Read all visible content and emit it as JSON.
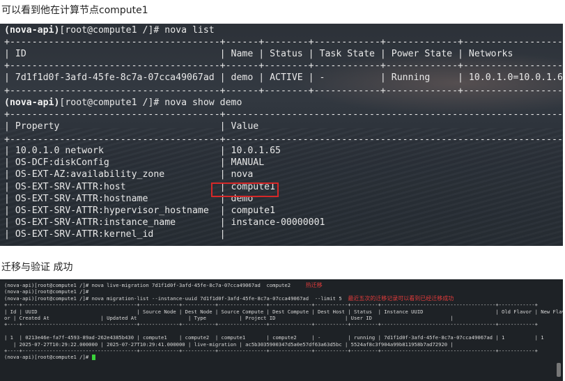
{
  "captions": {
    "first": "可以看到他在计算节点compute1",
    "second": "迁移与验证 成功"
  },
  "terminal1": {
    "lines": [
      {
        "prompt": "(nova-api)",
        "text": "[root@compute1 /]# nova list"
      },
      {
        "text": "+--------------------------------------+------+--------+------------+-------------+---------------------+"
      },
      {
        "text": "| ID                                   | Name | Status | Task State | Power State | Networks            |"
      },
      {
        "text": "+--------------------------------------+------+--------+------------+-------------+---------------------+"
      },
      {
        "text": "| 7d1f1d0f-3afd-45fe-8c7a-07cca49067ad | demo | ACTIVE | -          | Running     | 10.0.1.0=10.0.1.65  |"
      },
      {
        "text": "+--------------------------------------+------+--------+------------+-------------+---------------------+"
      },
      {
        "prompt": "(nova-api)",
        "text": "[root@compute1 /]# nova show demo"
      },
      {
        "text": "+--------------------------------------+----------------------------------------------------------------+"
      },
      {
        "text": "| Property                             | Value                                                          |"
      },
      {
        "text": "+--------------------------------------+----------------------------------------------------------------+"
      },
      {
        "text": "| 10.0.1.0 network                     | 10.0.1.65                                                      |"
      },
      {
        "text": "| OS-DCF:diskConfig                    | MANUAL                                                         |"
      },
      {
        "text": "| OS-EXT-AZ:availability_zone          | nova                                                           |"
      },
      {
        "text": "| OS-EXT-SRV-ATTR:host                 | compute1                                                       |"
      },
      {
        "text": "| OS-EXT-SRV-ATTR:hostname             | demo                                                           |"
      },
      {
        "text": "| OS-EXT-SRV-ATTR:hypervisor_hostname  | compute1                                                       |"
      },
      {
        "text": "| OS-EXT-SRV-ATTR:instance_name        | instance-00000001                                              |"
      },
      {
        "text": "| OS-EXT-SRV-ATTR:kernel_id            |                                                                |"
      }
    ]
  },
  "terminal2": {
    "lines": [
      {
        "text": "(nova-api)[root@compute1 /]# nova live-migration 7d1f1d0f-3afd-45fe-8c7a-07cca49067ad  compute2     ",
        "note": "热迁移"
      },
      {
        "text": "(nova-api)[root@compute1 /]#"
      },
      {
        "text": "(nova-api)[root@compute1 /]# nova migration-list --instance-uuid 7d1f1d0f-3afd-45fe-8c7a-07cca49067ad  --limit 5  ",
        "note": "最近五次的迁移记录可以看到已经迁移成功"
      },
      {
        "text": "+----+--------------------------------------+-------------+-----------+----------------+--------------+-----------+---------+--------------------------------------+------------+"
      },
      {
        "text": "| Id | UUID                                 | Source Node | Dest Node | Source Compute | Dest Compute | Dest Host | Status  | Instance UUID                        | Old Flavor | New Flav"
      },
      {
        "text": "or | Created At                 | Updated At                 | Type           | Project ID                       | User ID                          |"
      },
      {
        "text": "+----+--------------------------------------+-------------+-----------+----------------+--------------+-----------+---------+--------------------------------------+------------+"
      },
      {
        "text": ""
      },
      {
        "text": "| 1  | 0213e46e-fa7f-4593-89ad-262e4385b430 | compute1    | compute2  | compute1       | compute2     | -         | running | 7d1f1d0f-3afd-45fe-8c7a-07cca49067ad | 1          | 1"
      },
      {
        "text": "   | 2025-07-27T10:29:22.000000 | 2025-07-27T10:29:41.000000 | live-migration | ac5b3035900347d5a0e57df63a63d5bc | 5524af8c3f904a99b811958b7ad72920 |"
      },
      {
        "text": "+----+--------------------------------------+-------------+-----------+----------------+--------------+-----------+---------+--------------------------------------+------------+"
      },
      {
        "text": "(nova-api)[root@compute1 /]# ",
        "cursor": true
      }
    ]
  },
  "colors": {
    "highlight": "#d62828",
    "note": "#e23b3b",
    "cursor": "#3ad13a"
  }
}
